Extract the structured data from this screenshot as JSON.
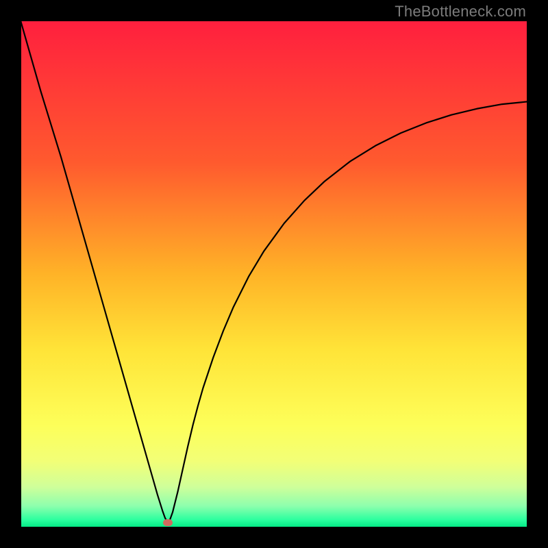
{
  "watermark": "TheBottleneck.com",
  "colors": {
    "frame_bg": "#000000",
    "curve": "#000000",
    "marker": "#cf6a5f",
    "watermark": "#7c7c7c",
    "gradient_stops": [
      {
        "pos": 0.0,
        "color": "#ff1f3e"
      },
      {
        "pos": 0.28,
        "color": "#ff5a2e"
      },
      {
        "pos": 0.5,
        "color": "#ffb327"
      },
      {
        "pos": 0.65,
        "color": "#ffe438"
      },
      {
        "pos": 0.8,
        "color": "#fdff5a"
      },
      {
        "pos": 0.87,
        "color": "#f2ff77"
      },
      {
        "pos": 0.92,
        "color": "#cfff9a"
      },
      {
        "pos": 0.958,
        "color": "#8dffad"
      },
      {
        "pos": 0.985,
        "color": "#2bff9f"
      },
      {
        "pos": 1.0,
        "color": "#00e783"
      }
    ]
  },
  "chart_data": {
    "type": "line",
    "title": "",
    "xlabel": "",
    "ylabel": "",
    "xlim": [
      0,
      100
    ],
    "ylim": [
      0,
      100
    ],
    "grid": false,
    "x": [
      0,
      2,
      4,
      6,
      8,
      10,
      12,
      14,
      16,
      18,
      20,
      22,
      24,
      26,
      27,
      28,
      28.5,
      29,
      29.5,
      30,
      31,
      32,
      33,
      34,
      35,
      36,
      38,
      40,
      42,
      45,
      48,
      52,
      56,
      60,
      65,
      70,
      75,
      80,
      85,
      90,
      95,
      100
    ],
    "values": [
      100,
      93,
      86,
      79.5,
      73,
      66,
      59,
      52,
      45,
      38,
      31,
      24,
      17,
      10,
      6.5,
      3.3,
      1.9,
      1.0,
      1.6,
      3.0,
      7.0,
      11.5,
      16,
      20.2,
      24,
      27.5,
      33.5,
      38.8,
      43.5,
      49.5,
      54.5,
      60.0,
      64.5,
      68.3,
      72.2,
      75.3,
      77.8,
      79.8,
      81.4,
      82.6,
      83.5,
      84.0
    ],
    "minimum_point": {
      "x": 29,
      "y": 1.0
    }
  }
}
